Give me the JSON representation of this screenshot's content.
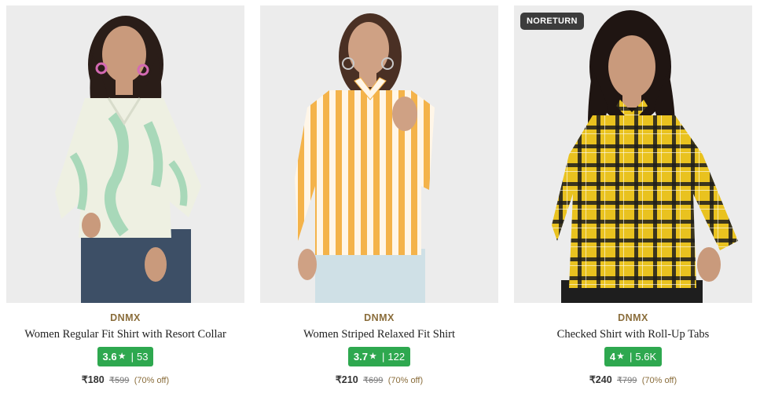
{
  "products": [
    {
      "brand": "DNMX",
      "name": "Women Regular Fit Shirt with Resort Collar",
      "rating": "3.6",
      "star": "★",
      "rating_count": "53",
      "price": "₹180",
      "mrp": "₹599",
      "discount": "(70% off)",
      "colors": {
        "shirt": "#eef0e2",
        "pattern": "#a8d8b9",
        "pants": "#3d4f66",
        "hair": "#2a1d18"
      }
    },
    {
      "brand": "DNMX",
      "name": "Women Striped Relaxed Fit Shirt",
      "rating": "3.7",
      "star": "★",
      "rating_count": "122",
      "price": "₹210",
      "mrp": "₹699",
      "discount": "(70% off)",
      "colors": {
        "shirt": "#fff6e8",
        "pattern": "#f4b34a",
        "pants": "#cfe0e6",
        "hair": "#4a3024"
      }
    },
    {
      "brand": "DNMX",
      "badge": "NORETURN",
      "name": "Checked Shirt with Roll-Up Tabs",
      "rating": "4",
      "star": "★",
      "rating_count": "5.6K",
      "price": "₹240",
      "mrp": "₹799",
      "discount": "(70% off)",
      "colors": {
        "shirt": "#e9c21f",
        "pattern": "#1c1c1c",
        "pants": "#1e1e1e",
        "hair": "#1f1512"
      }
    }
  ],
  "theme": {
    "rating_bg": "#2ea84f",
    "brand_color": "#8a6d3b",
    "image_bg": "#ebebeb"
  }
}
